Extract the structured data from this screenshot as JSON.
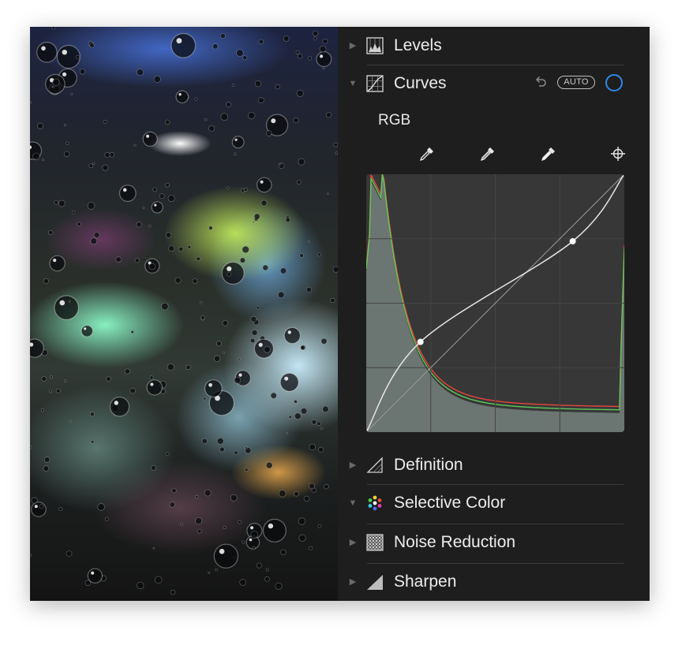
{
  "panel": {
    "sections": [
      {
        "id": "levels",
        "label": "Levels",
        "expanded": false,
        "icon": "levels-icon"
      },
      {
        "id": "curves",
        "label": "Curves",
        "expanded": true,
        "icon": "curves-icon"
      },
      {
        "id": "definition",
        "label": "Definition",
        "expanded": false,
        "icon": "definition-icon"
      },
      {
        "id": "selective_color",
        "label": "Selective Color",
        "expanded": true,
        "icon": "selective-color-icon"
      },
      {
        "id": "noise_reduction",
        "label": "Noise Reduction",
        "expanded": false,
        "icon": "noise-reduction-icon"
      },
      {
        "id": "sharpen",
        "label": "Sharpen",
        "expanded": false,
        "icon": "sharpen-icon"
      }
    ]
  },
  "curves": {
    "auto_label": "AUTO",
    "channel": "RGB",
    "toggle_color": "#2f86e6",
    "tools": [
      "black-point-eyedropper-icon",
      "gray-point-eyedropper-icon",
      "white-point-eyedropper-icon",
      "target-adjust-icon"
    ],
    "control_points": [
      {
        "input": 0.21,
        "output": 0.35
      },
      {
        "input": 0.8,
        "output": 0.74
      }
    ],
    "histogram_colors": {
      "red": "#e8463c",
      "green": "#5ec85a",
      "gray": "#8a9a95"
    }
  }
}
